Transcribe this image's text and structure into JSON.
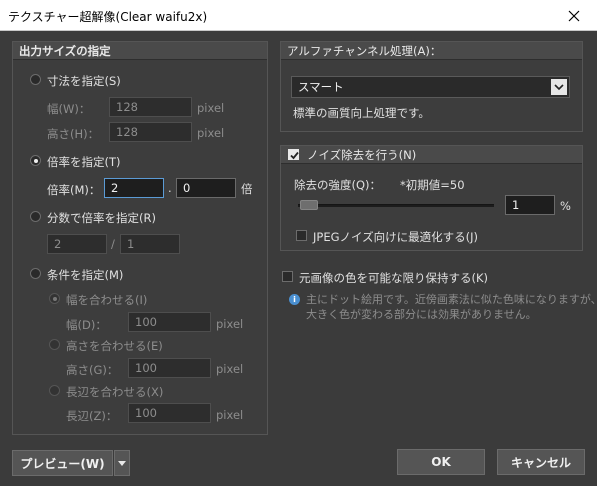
{
  "window": {
    "title": "テクスチャー超解像(Clear waifu2x)"
  },
  "output_size": {
    "header": "出力サイズの指定",
    "specify_dimensions": {
      "label": "寸法を指定(S)",
      "width_label": "幅(W)：",
      "width_value": "128",
      "width_unit": "pixel",
      "height_label": "高さ(H)：",
      "height_value": "128",
      "height_unit": "pixel"
    },
    "specify_scale": {
      "label": "倍率を指定(T)",
      "scale_label": "倍率(M)：",
      "scale_int": "2",
      "dot": ".",
      "scale_frac": "0",
      "unit": "倍"
    },
    "specify_fraction": {
      "label": "分数で倍率を指定(R)",
      "numerator": "2",
      "slash": "/",
      "denominator": "1"
    },
    "specify_condition": {
      "label": "条件を指定(M)",
      "fit_width": {
        "label": "幅を合わせる(I)",
        "field_label": "幅(D)：",
        "value": "100",
        "unit": "pixel"
      },
      "fit_height": {
        "label": "高さを合わせる(E)",
        "field_label": "高さ(G)：",
        "value": "100",
        "unit": "pixel"
      },
      "fit_long_side": {
        "label": "長辺を合わせる(X)",
        "field_label": "長辺(Z)：",
        "value": "100",
        "unit": "pixel"
      }
    }
  },
  "alpha_channel": {
    "header": "アルファチャンネル処理(A)：",
    "selected": "スマート",
    "description": "標準の画質向上処理です。"
  },
  "noise_removal": {
    "header": "ノイズ除去を行う(N)",
    "checked": true,
    "strength_label": "除去の強度(Q)：",
    "initial_note": "*初期値=50",
    "value": "1",
    "unit": "%",
    "slider_fraction": 0.01,
    "jpeg_label": "JPEGノイズ向けに最適化する(J)",
    "jpeg_checked": false
  },
  "keep_colors": {
    "label": "元画像の色を可能な限り保持する(K)",
    "checked": false,
    "info_line1": "主にドット絵用です。近傍画素法に似た色味になりますが、",
    "info_line2": "大きく色が変わる部分には効果がありません。"
  },
  "buttons": {
    "preview": "プレビュー(W)",
    "ok": "OK",
    "cancel": "キャンセル"
  }
}
